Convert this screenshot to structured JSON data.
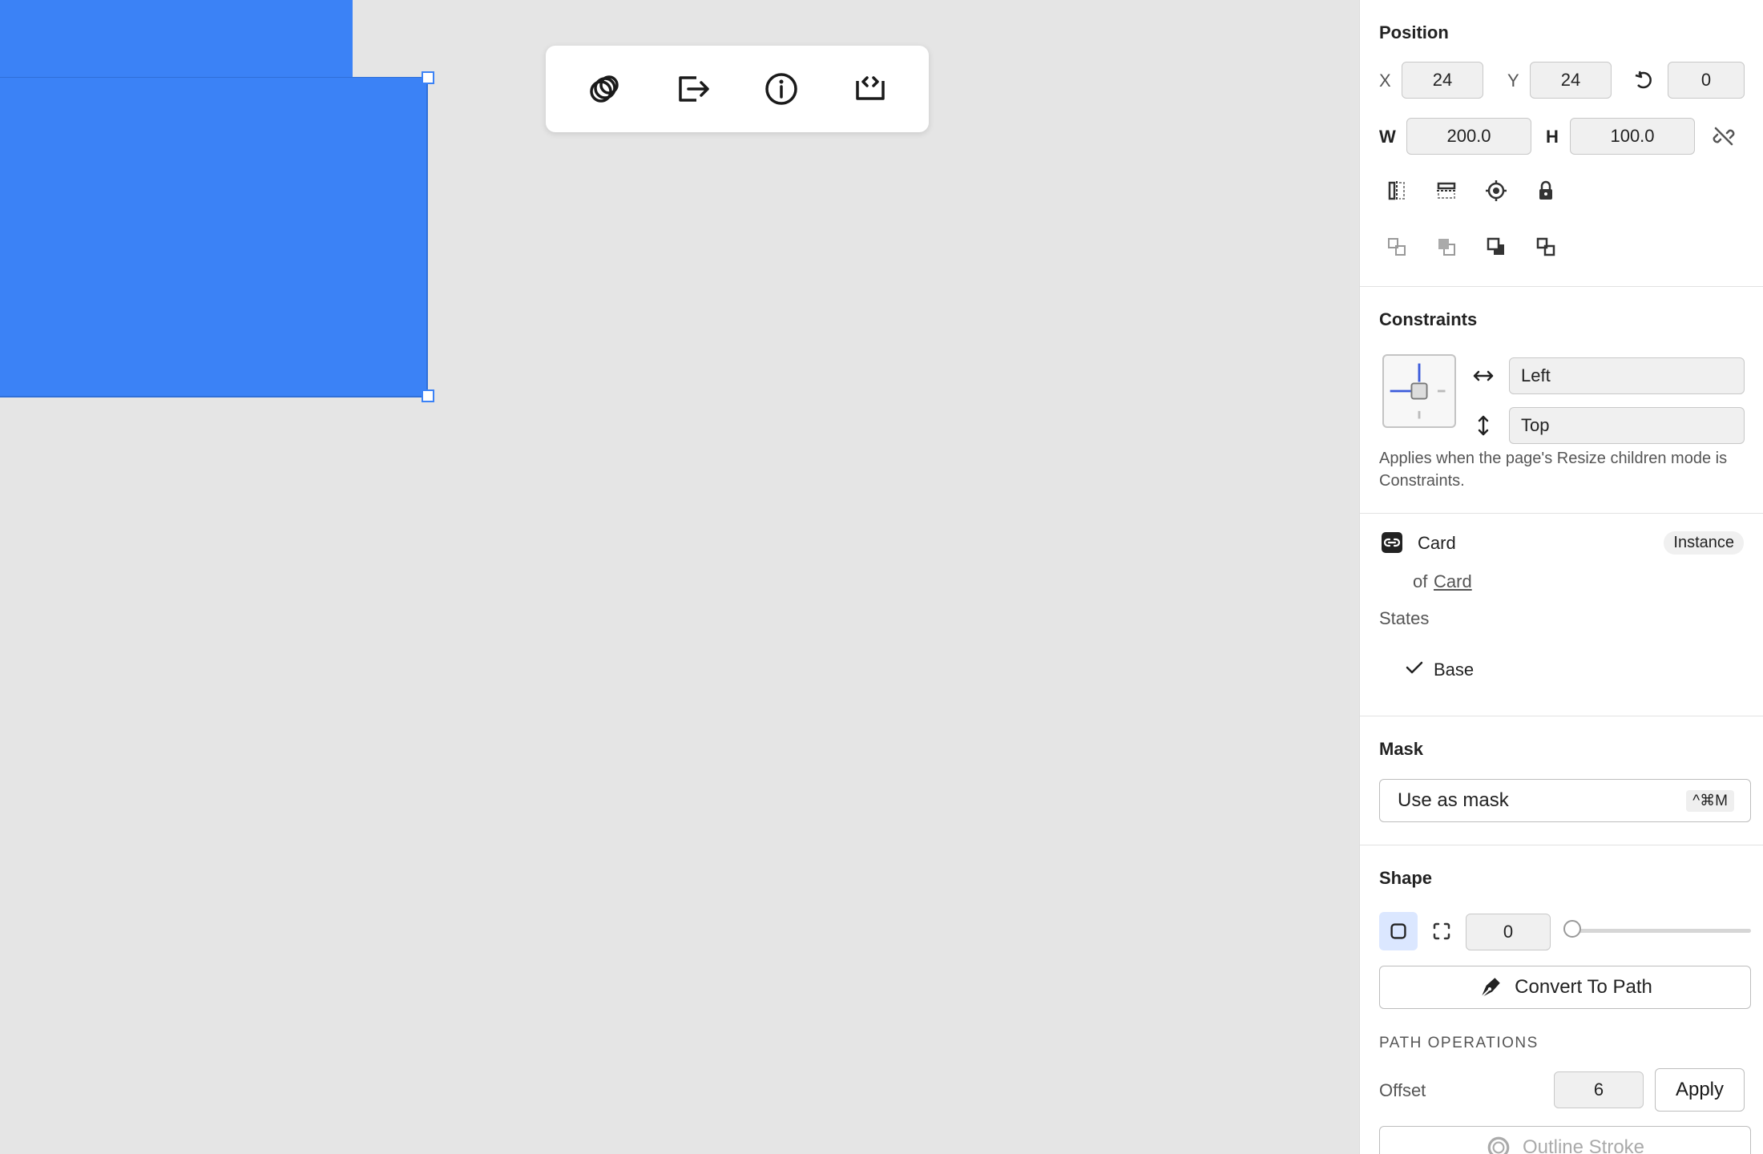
{
  "toolbar": {
    "buttons": [
      {
        "icon": "overlapping-circles-icon"
      },
      {
        "icon": "export-arrow-icon"
      },
      {
        "icon": "info-icon"
      },
      {
        "icon": "code-embed-icon"
      }
    ]
  },
  "position": {
    "title": "Position",
    "x_label": "X",
    "x_value": "24",
    "y_label": "Y",
    "y_value": "24",
    "rotation_value": "0",
    "w_label": "W",
    "w_value": "200.0",
    "h_label": "H",
    "h_value": "100.0"
  },
  "constraints": {
    "title": "Constraints",
    "horizontal": "Left",
    "vertical": "Top",
    "note": "Applies when the page's Resize children mode is Constraints."
  },
  "component": {
    "name": "Card",
    "badge": "Instance",
    "of_prefix": "of",
    "of_link": "Card",
    "states_label": "States",
    "state_base": "Base"
  },
  "mask": {
    "title": "Mask",
    "button_label": "Use as mask",
    "shortcut": "^⌘M"
  },
  "shape": {
    "title": "Shape",
    "radius_value": "0",
    "slider_value": 0,
    "convert_label": "Convert To Path",
    "path_ops_label": "PATH OPERATIONS",
    "offset_label": "Offset",
    "offset_value": "6",
    "apply_label": "Apply",
    "outline_label": "Outline Stroke"
  },
  "colors": {
    "accent": "#3b82f6",
    "canvas": "#e5e5e5"
  }
}
